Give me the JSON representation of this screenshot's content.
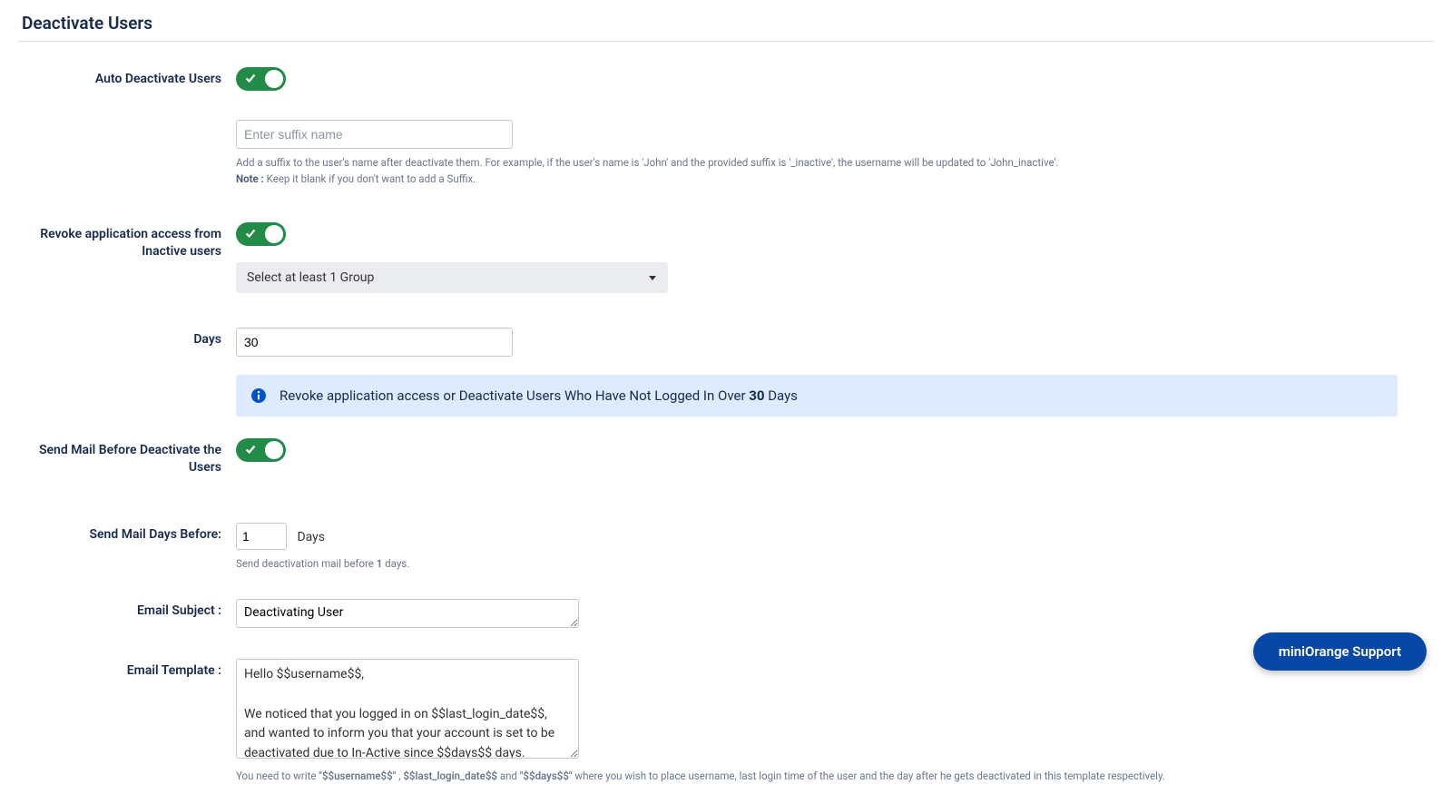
{
  "page": {
    "title": "Deactivate Users"
  },
  "auto_deactivate": {
    "label": "Auto Deactivate Users",
    "suffix_placeholder": "Enter suffix name",
    "help_line": "Add a suffix to the user's name after deactivate them. For example, if the user's name is 'John' and the provided suffix is '_inactive', the username will be updated to 'John_inactive'.",
    "note_prefix": "Note :",
    "note_text": " Keep it blank if you don't want to add a Suffix."
  },
  "revoke": {
    "label": "Revoke application access from Inactive users",
    "group_select_placeholder": "Select at least 1 Group"
  },
  "days": {
    "label": "Days",
    "value": "30"
  },
  "banner": {
    "text_before": "Revoke application access or Deactivate Users Who Have Not Logged In Over ",
    "bold": "30",
    "text_after": " Days"
  },
  "send_mail": {
    "label": "Send Mail Before Deactivate the Users"
  },
  "mail_days": {
    "label": "Send Mail Days Before:",
    "value": "1",
    "unit": "Days",
    "help_before": "Send deactivation mail before ",
    "help_bold": "1",
    "help_after": " days."
  },
  "subject": {
    "label": "Email Subject :",
    "value": "Deactivating User"
  },
  "template": {
    "label": "Email Template :",
    "value": "Hello $$username$$,\n\nWe noticed that you logged in on $$last_login_date$$, and wanted to inform you that your account is set to be deactivated due to In-Active since $$days$$ days.",
    "help_before": "You need to write ",
    "token1": "\"$$username$$\"",
    "sep1": " , ",
    "token2": "$$last_login_date$$",
    "sep2": " and ",
    "token3": "\"$$days$$\"",
    "help_after": " where you wish to place username, last login time of the user and the day after he gets deactivated in this template respectively."
  },
  "support": {
    "label": "miniOrange Support"
  }
}
